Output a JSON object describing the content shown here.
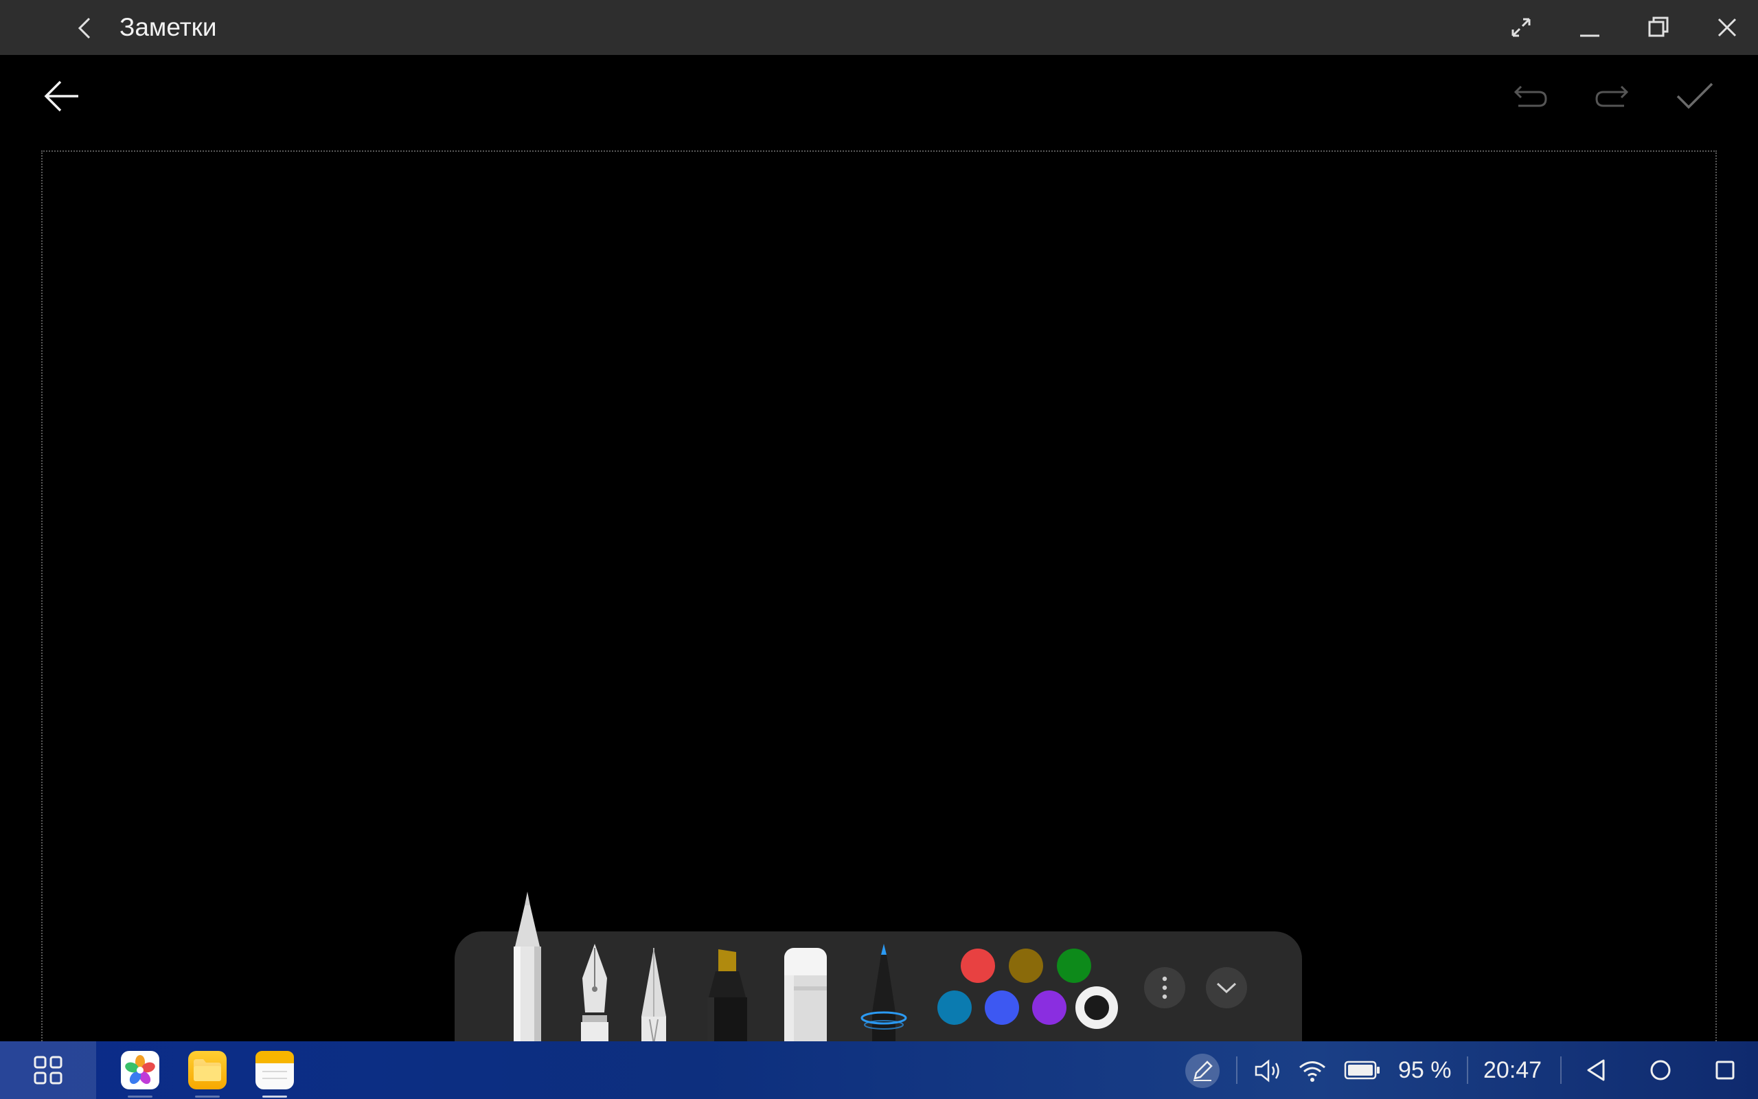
{
  "window": {
    "title": "Заметки"
  },
  "palette": {
    "colors": [
      {
        "name": "red",
        "hex": "#e84141"
      },
      {
        "name": "olive",
        "hex": "#8a6a0a"
      },
      {
        "name": "green",
        "hex": "#0d8a1a"
      },
      {
        "name": "teal-blue",
        "hex": "#0b7bb0"
      },
      {
        "name": "blue",
        "hex": "#3d58f2"
      },
      {
        "name": "purple",
        "hex": "#8a2ee0"
      },
      {
        "name": "black",
        "hex": "#1a1a1a"
      }
    ],
    "selected_color": "black"
  },
  "pen_tools": [
    {
      "name": "ballpoint-pen",
      "selected": true
    },
    {
      "name": "fountain-pen",
      "selected": false
    },
    {
      "name": "calligraphy-pen",
      "selected": false
    },
    {
      "name": "highlighter",
      "selected": false
    },
    {
      "name": "eraser",
      "selected": false
    },
    {
      "name": "lasso-pen",
      "selected": false
    }
  ],
  "taskbar": {
    "apps": [
      "photos-app",
      "files-app",
      "notes-app"
    ],
    "battery": "95 %",
    "time": "20:47"
  }
}
